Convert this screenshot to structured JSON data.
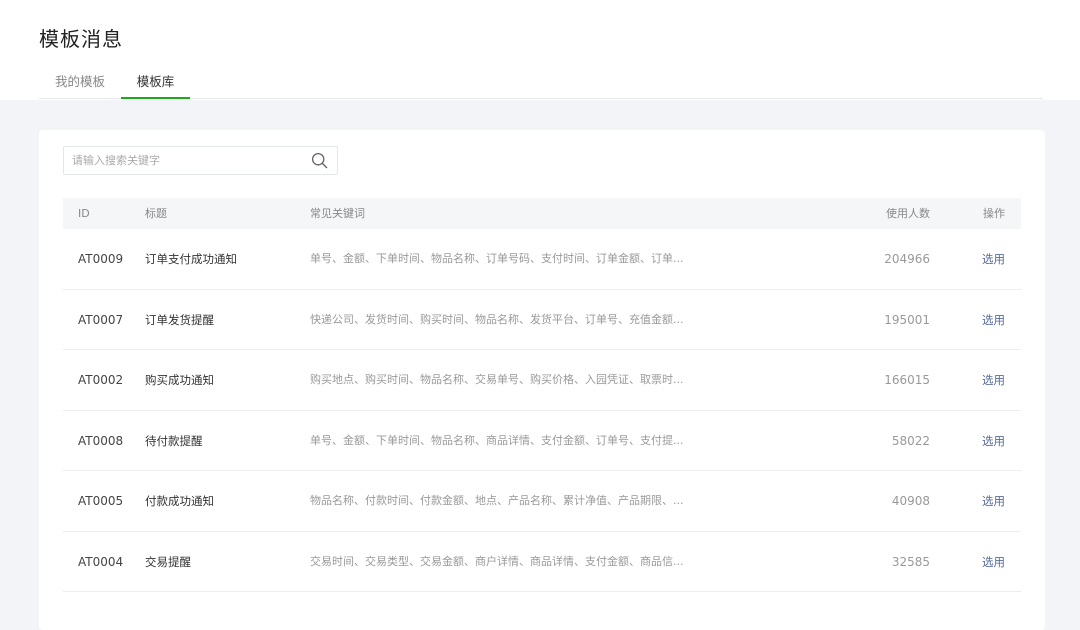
{
  "page": {
    "title": "模板消息"
  },
  "tabs": [
    {
      "label": "我的模板",
      "active": false
    },
    {
      "label": "模板库",
      "active": true
    }
  ],
  "search": {
    "placeholder": "请输入搜索关键字",
    "value": ""
  },
  "table": {
    "headers": {
      "id": "ID",
      "title": "标题",
      "keywords": "常见关键词",
      "count": "使用人数",
      "action": "操作"
    },
    "rows": [
      {
        "id": "AT0009",
        "title": "订单支付成功通知",
        "keywords": "单号、金额、下单时间、物品名称、订单号码、支付时间、订单金额、订单...",
        "count": "204966",
        "action": "选用"
      },
      {
        "id": "AT0007",
        "title": "订单发货提醒",
        "keywords": "快递公司、发货时间、购买时间、物品名称、发货平台、订单号、充值金额...",
        "count": "195001",
        "action": "选用"
      },
      {
        "id": "AT0002",
        "title": "购买成功通知",
        "keywords": "购买地点、购买时间、物品名称、交易单号、购买价格、入园凭证、取票时...",
        "count": "166015",
        "action": "选用"
      },
      {
        "id": "AT0008",
        "title": "待付款提醒",
        "keywords": "单号、金额、下单时间、物品名称、商品详情、支付金额、订单号、支付提...",
        "count": "58022",
        "action": "选用"
      },
      {
        "id": "AT0005",
        "title": "付款成功通知",
        "keywords": "物品名称、付款时间、付款金额、地点、产品名称、累计净值、产品期限、...",
        "count": "40908",
        "action": "选用"
      },
      {
        "id": "AT0004",
        "title": "交易提醒",
        "keywords": "交易时间、交易类型、交易金额、商户详情、商品详情、支付金额、商品信...",
        "count": "32585",
        "action": "选用"
      }
    ]
  },
  "colors": {
    "accent": "#1aad19",
    "link": "#576b95"
  },
  "icons": {
    "search": "search-icon"
  }
}
